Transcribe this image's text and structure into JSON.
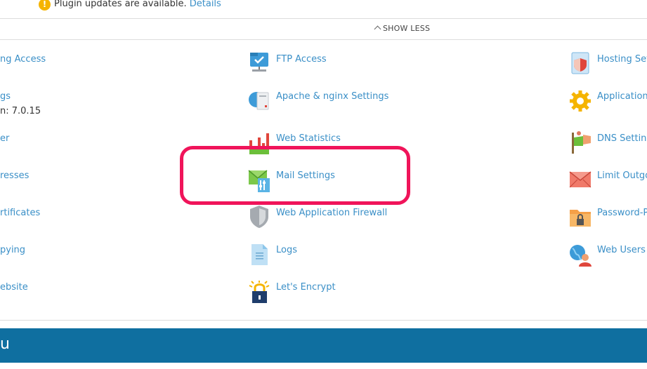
{
  "notice": {
    "text": "Plugin updates are available.",
    "link": "Details"
  },
  "show_less": "SHOW LESS",
  "left_column": [
    {
      "label": "ng Access"
    },
    {
      "label": "gs",
      "sub": "n: 7.0.15"
    },
    {
      "label": "er"
    },
    {
      "label": "resses"
    },
    {
      "label": "rtificates"
    },
    {
      "label": "pying"
    },
    {
      "label": "ebsite"
    }
  ],
  "middle_column": [
    {
      "label": "FTP Access",
      "icon": "ftp-access-icon"
    },
    {
      "label": "Apache & nginx Settings",
      "icon": "apache-nginx-icon"
    },
    {
      "label": "Web Statistics",
      "icon": "web-statistics-icon"
    },
    {
      "label": "Mail Settings",
      "icon": "mail-settings-icon"
    },
    {
      "label": "Web Application Firewall",
      "icon": "shield-icon"
    },
    {
      "label": "Logs",
      "icon": "logs-icon"
    },
    {
      "label": "Let's Encrypt",
      "icon": "lets-encrypt-icon"
    }
  ],
  "right_column": [
    {
      "label": "Hosting Sett",
      "icon": "hosting-settings-icon"
    },
    {
      "label": "Applications",
      "icon": "applications-gear-icon"
    },
    {
      "label": "DNS Setting",
      "icon": "dns-settings-icon"
    },
    {
      "label": "Limit Outgo",
      "icon": "envelope-icon"
    },
    {
      "label": "Password-P",
      "icon": "password-protected-folder-icon"
    },
    {
      "label": "Web Users",
      "icon": "web-users-icon"
    }
  ],
  "bottom_bar": {
    "text": "u"
  },
  "colors": {
    "link": "#3a8fc7",
    "highlight": "#f0145a",
    "bar": "#0f6fa0"
  }
}
